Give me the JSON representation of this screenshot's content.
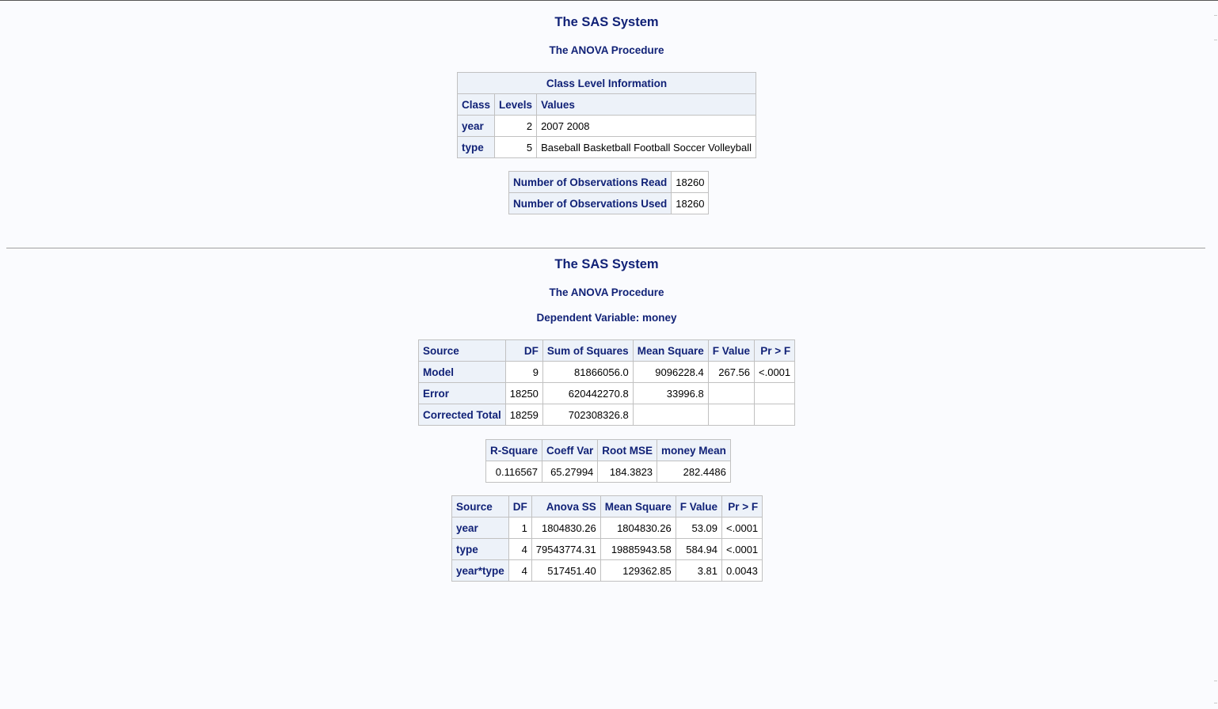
{
  "section1": {
    "title": "The SAS System",
    "procedure": "The ANOVA Procedure",
    "class_level": {
      "caption": "Class Level Information",
      "headers": [
        "Class",
        "Levels",
        "Values"
      ],
      "rows": [
        {
          "class": "year",
          "levels": "2",
          "values": "2007 2008"
        },
        {
          "class": "type",
          "levels": "5",
          "values": "Baseball Basketball Football Soccer Volleyball"
        }
      ]
    },
    "observations": [
      {
        "label": "Number of Observations Read",
        "value": "18260"
      },
      {
        "label": "Number of Observations Used",
        "value": "18260"
      }
    ]
  },
  "section2": {
    "title": "The SAS System",
    "procedure": "The ANOVA Procedure",
    "dependent": "Dependent Variable: money",
    "anova": {
      "headers": [
        "Source",
        "DF",
        "Sum of Squares",
        "Mean Square",
        "F Value",
        "Pr > F"
      ],
      "rows": [
        {
          "source": "Model",
          "df": "9",
          "ss": "81866056.0",
          "ms": "9096228.4",
          "f": "267.56",
          "p": "<.0001"
        },
        {
          "source": "Error",
          "df": "18250",
          "ss": "620442270.8",
          "ms": "33996.8",
          "f": "",
          "p": ""
        },
        {
          "source": "Corrected Total",
          "df": "18259",
          "ss": "702308326.8",
          "ms": "",
          "f": "",
          "p": ""
        }
      ]
    },
    "fit": {
      "headers": [
        "R-Square",
        "Coeff Var",
        "Root MSE",
        "money Mean"
      ],
      "values": [
        "0.116567",
        "65.27994",
        "184.3823",
        "282.4486"
      ]
    },
    "effects": {
      "headers": [
        "Source",
        "DF",
        "Anova SS",
        "Mean Square",
        "F Value",
        "Pr > F"
      ],
      "rows": [
        {
          "source": "year",
          "df": "1",
          "ss": "1804830.26",
          "ms": "1804830.26",
          "f": "53.09",
          "p": "<.0001"
        },
        {
          "source": "type",
          "df": "4",
          "ss": "79543774.31",
          "ms": "19885943.58",
          "f": "584.94",
          "p": "<.0001"
        },
        {
          "source": "year*type",
          "df": "4",
          "ss": "517451.40",
          "ms": "129362.85",
          "f": "3.81",
          "p": "0.0043"
        }
      ]
    }
  }
}
